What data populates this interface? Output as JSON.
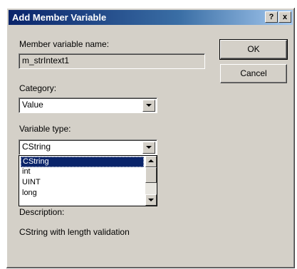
{
  "window": {
    "title": "Add Member Variable",
    "help_glyph": "?",
    "close_glyph": "x"
  },
  "member_name": {
    "label": "Member variable name:",
    "value": "m_strIntext1"
  },
  "category": {
    "label": "Category:",
    "value": "Value"
  },
  "variable_type": {
    "label": "Variable type:",
    "value": "CString",
    "options": [
      "CString",
      "int",
      "UINT",
      "long"
    ],
    "selected_index": 0
  },
  "description": {
    "label": "Description:",
    "text": "CString with length validation"
  },
  "buttons": {
    "ok": "OK",
    "cancel": "Cancel"
  },
  "colors": {
    "title_bar": "#0a246a",
    "dialog_bg": "#d4d0c8",
    "selection": "#0a246a"
  },
  "icons": {
    "help": "question-mark",
    "close": "x-mark",
    "dropdown": "chevron-down",
    "scroll_up": "arrow-up",
    "scroll_down": "arrow-down"
  }
}
